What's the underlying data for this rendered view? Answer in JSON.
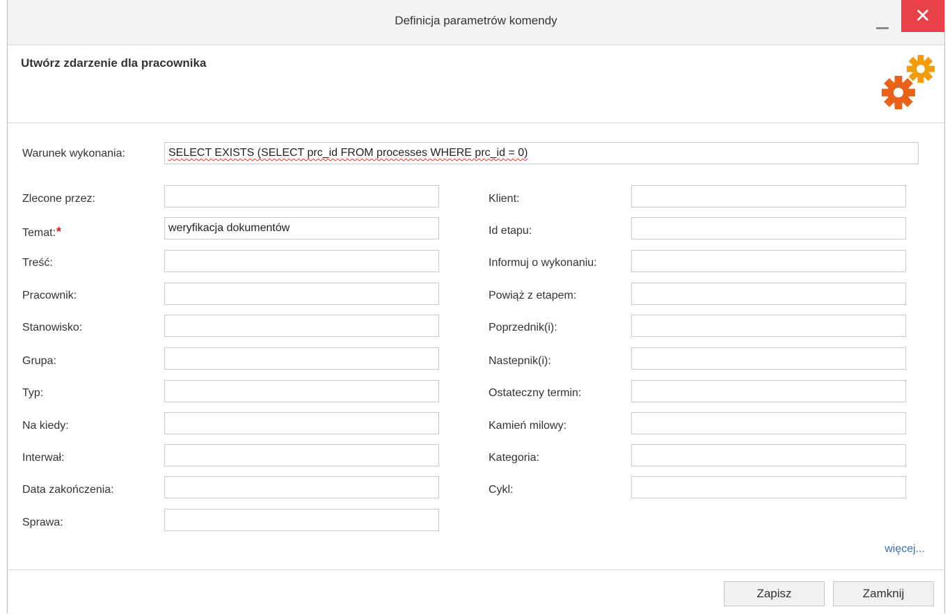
{
  "window": {
    "title": "Definicja parametrów komendy",
    "close_glyph": "✕"
  },
  "header": {
    "heading": "Utwórz zdarzenie dla pracownika",
    "icon": "gears-icon",
    "gear_colors": [
      "#f29b0c",
      "#e8621c"
    ]
  },
  "condition": {
    "label": "Warunek wykonania:",
    "value": "SELECT EXISTS (SELECT prc_id FROM processes WHERE prc_id = 0)"
  },
  "left_fields": [
    {
      "label": "Zlecone przez:",
      "value": ""
    },
    {
      "label": "Temat:",
      "value": "weryfikacja dokumentów",
      "required": true
    },
    {
      "label": "Treść:",
      "value": ""
    },
    {
      "label": "Pracownik:",
      "value": ""
    },
    {
      "label": "Stanowisko:",
      "value": ""
    },
    {
      "label": "Grupa:",
      "value": ""
    },
    {
      "label": "Typ:",
      "value": ""
    },
    {
      "label": "Na kiedy:",
      "value": ""
    },
    {
      "label": "Interwał:",
      "value": ""
    },
    {
      "label": "Data zakończenia:",
      "value": ""
    },
    {
      "label": "Sprawa:",
      "value": ""
    }
  ],
  "right_fields": [
    {
      "label": "Klient:",
      "value": ""
    },
    {
      "label": "Id etapu:",
      "value": ""
    },
    {
      "label": "Informuj o wykonaniu:",
      "value": ""
    },
    {
      "label": "Powiąż z etapem:",
      "value": ""
    },
    {
      "label": "Poprzednik(i):",
      "value": ""
    },
    {
      "label": "Nastepnik(i):",
      "value": ""
    },
    {
      "label": "Ostateczny termin:",
      "value": ""
    },
    {
      "label": "Kamień milowy:",
      "value": ""
    },
    {
      "label": "Kategoria:",
      "value": ""
    },
    {
      "label": "Cykl:",
      "value": ""
    }
  ],
  "more_link": "więcej...",
  "footer": {
    "save_label": "Zapisz",
    "close_label": "Zamknij"
  },
  "colors": {
    "close_button": "#e8414a",
    "required_star": "#d41e1e",
    "link": "#3a6fb0"
  }
}
